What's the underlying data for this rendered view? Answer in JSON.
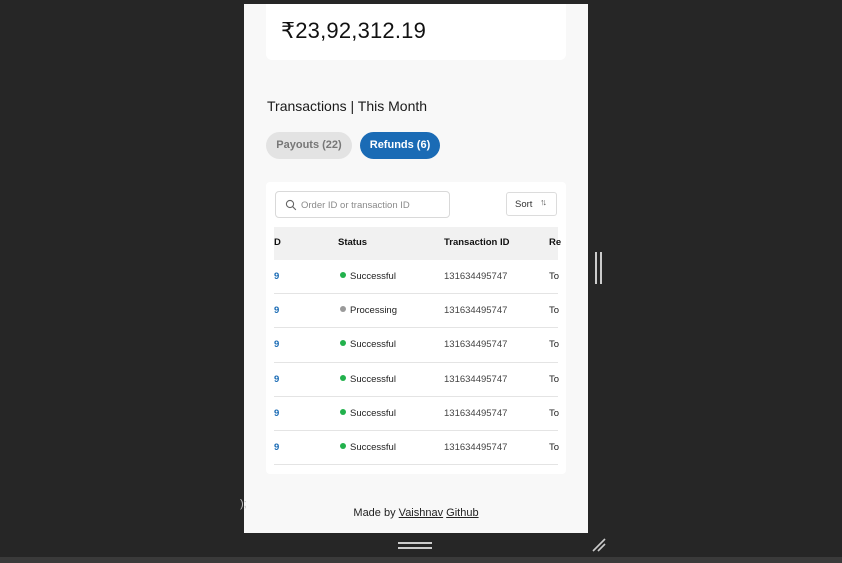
{
  "balance": {
    "amount": "₹23,92,312.19"
  },
  "transactions": {
    "title": "Transactions | This Month",
    "tabs": [
      {
        "label": "Payouts (22)",
        "active": false
      },
      {
        "label": "Refunds (6)",
        "active": true
      }
    ],
    "search": {
      "placeholder": "Order ID or transaction ID",
      "value": "",
      "icon": "search-icon"
    },
    "sort": {
      "label": "Sort",
      "icon": "sort-arrows-icon"
    },
    "columns": [
      "D",
      "Status",
      "Transaction ID",
      "Re"
    ],
    "rows": [
      {
        "id": "9",
        "status": "Successful",
        "txn": "131634495747",
        "extra": "To"
      },
      {
        "id": "9",
        "status": "Processing",
        "txn": "131634495747",
        "extra": "To"
      },
      {
        "id": "9",
        "status": "Successful",
        "txn": "131634495747",
        "extra": "To"
      },
      {
        "id": "9",
        "status": "Successful",
        "txn": "131634495747",
        "extra": "To"
      },
      {
        "id": "9",
        "status": "Successful",
        "txn": "131634495747",
        "extra": "To"
      },
      {
        "id": "9",
        "status": "Successful",
        "txn": "131634495747",
        "extra": "To"
      }
    ]
  },
  "footer": {
    "prefix": "Made by",
    "author": "Vaishnav",
    "link": "Github"
  },
  "stray_text": ");",
  "colors": {
    "accent": "#1a6bb5",
    "successful": "#22b14c",
    "processing": "#9a9a9a"
  }
}
